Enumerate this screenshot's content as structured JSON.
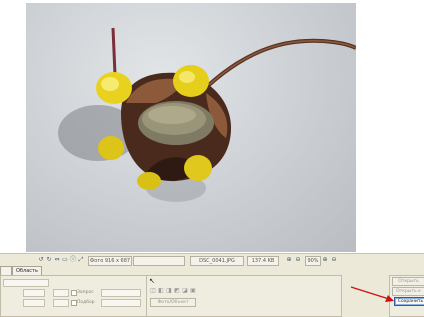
{
  "status_bar": {
    "photo_size": "Фото 916 x 687",
    "filename": "DSC_0041.JPG",
    "file_size": "137.4 KB",
    "zoom": "90%"
  },
  "panel": {
    "tabs": [
      "",
      "Область"
    ],
    "photo_object_button": "Фото/Объект",
    "open_button": "Открыть",
    "open_as_button": "Открыть к",
    "save_button": "Сохранить",
    "checkbox_labels": [
      "Запрос",
      "Подбор"
    ]
  },
  "colors": {
    "annotation_arrow": "#d01010",
    "selection_highlight": "#2f5aa8"
  }
}
